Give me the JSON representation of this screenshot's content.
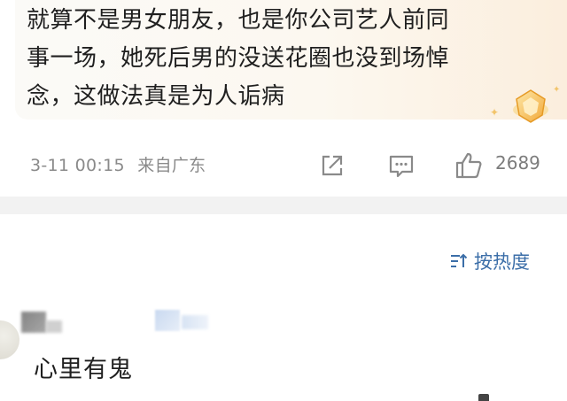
{
  "comment": {
    "line1": "就算不是男女朋友，也是你公司艺人前同",
    "line2": "事一场，她死后男的没送花圈也没到场悼",
    "line3": "念，这做法真是为人诟病",
    "date": "3-11 00:15",
    "location": "来自广东",
    "like_count": "2689"
  },
  "sort": {
    "label": "按热度"
  },
  "reply": {
    "text": "心里有鬼"
  },
  "icons": {
    "share": "share-icon",
    "comment": "comment-icon",
    "like": "thumbs-up-icon",
    "sort": "sort-icon",
    "badge": "gold-badge-icon"
  },
  "colors": {
    "accent": "#3b6ea8",
    "meta": "#8a8a8a",
    "divider": "#f2f2f2",
    "badge": "#f4b73a"
  }
}
